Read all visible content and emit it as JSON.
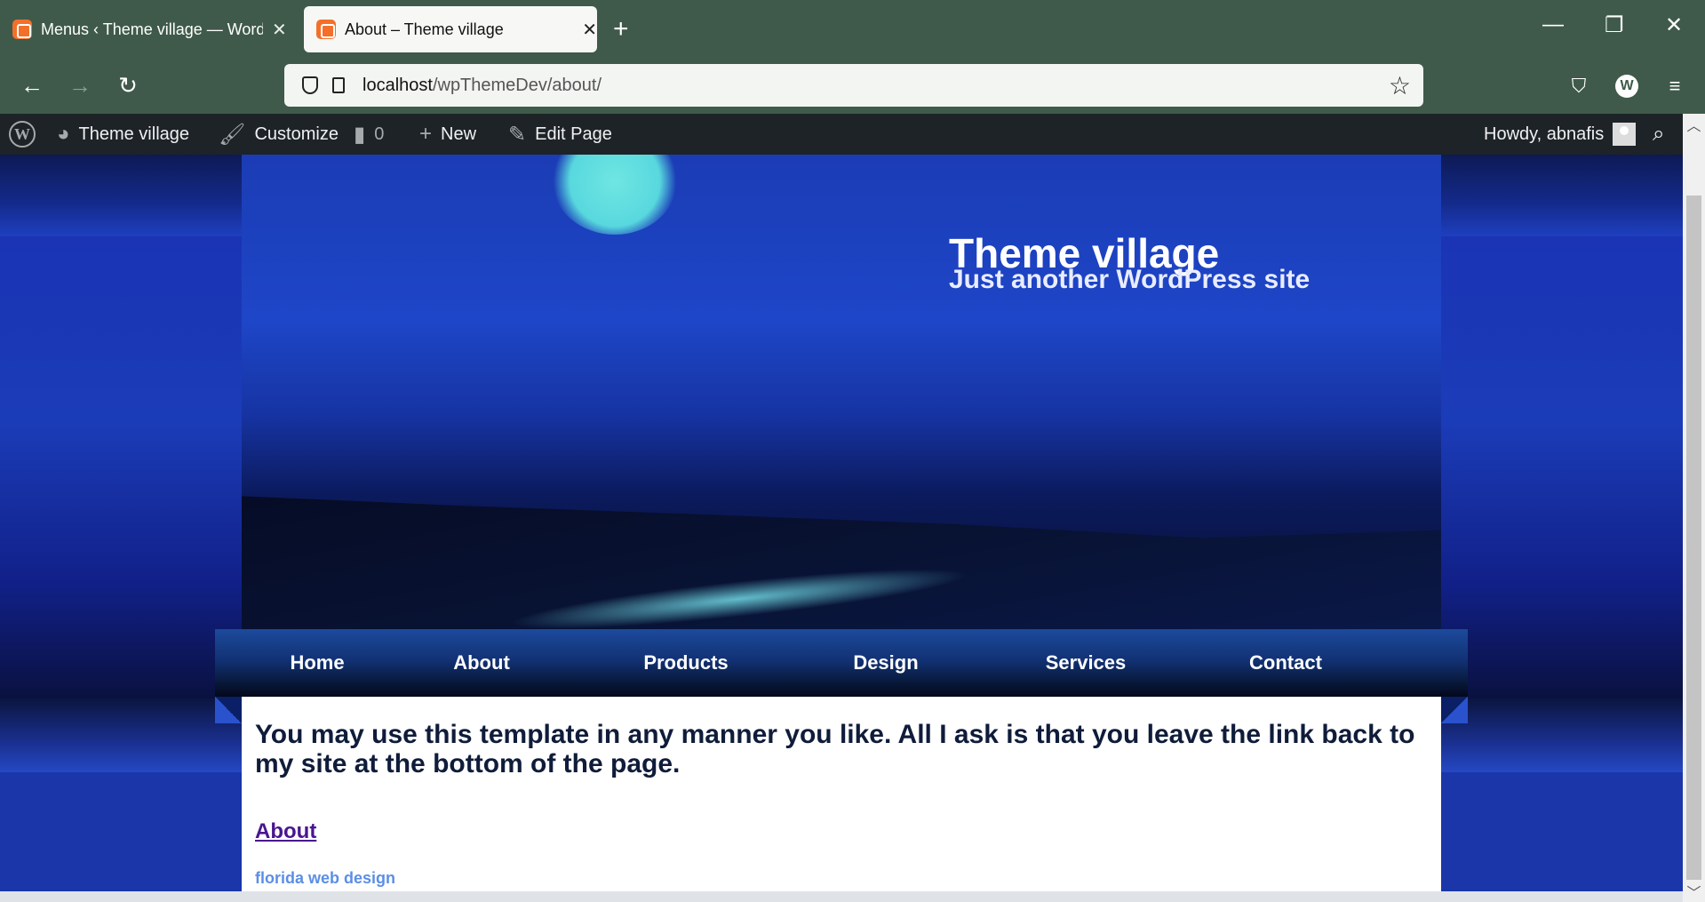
{
  "browser": {
    "tabs": [
      {
        "title": "Menus ‹ Theme village — WordPress"
      },
      {
        "title": "About – Theme village"
      }
    ],
    "url_host": "localhost",
    "url_path": "/wpThemeDev/about/",
    "account_initial": "W"
  },
  "adminbar": {
    "site_name": "Theme village",
    "customize": "Customize",
    "comments_count": "0",
    "new_label": "New",
    "edit_label": "Edit Page",
    "howdy": "Howdy, abnafis"
  },
  "site": {
    "title": "Theme village",
    "tagline": "Just another WordPress site"
  },
  "menu": [
    "Home",
    "About",
    "Products",
    "Design",
    "Services",
    "Contact"
  ],
  "content": {
    "intro": "You may use this template in any manner you like. All I ask is that you leave the link back to my site at the bottom of the page.",
    "heading_link": "About",
    "credit_link": "florida web design"
  },
  "colors": {
    "browser_chrome": "#3f5a4a",
    "adminbar": "#1d2327",
    "link_visited": "#4a1590",
    "credit": "#5b8ee6"
  }
}
